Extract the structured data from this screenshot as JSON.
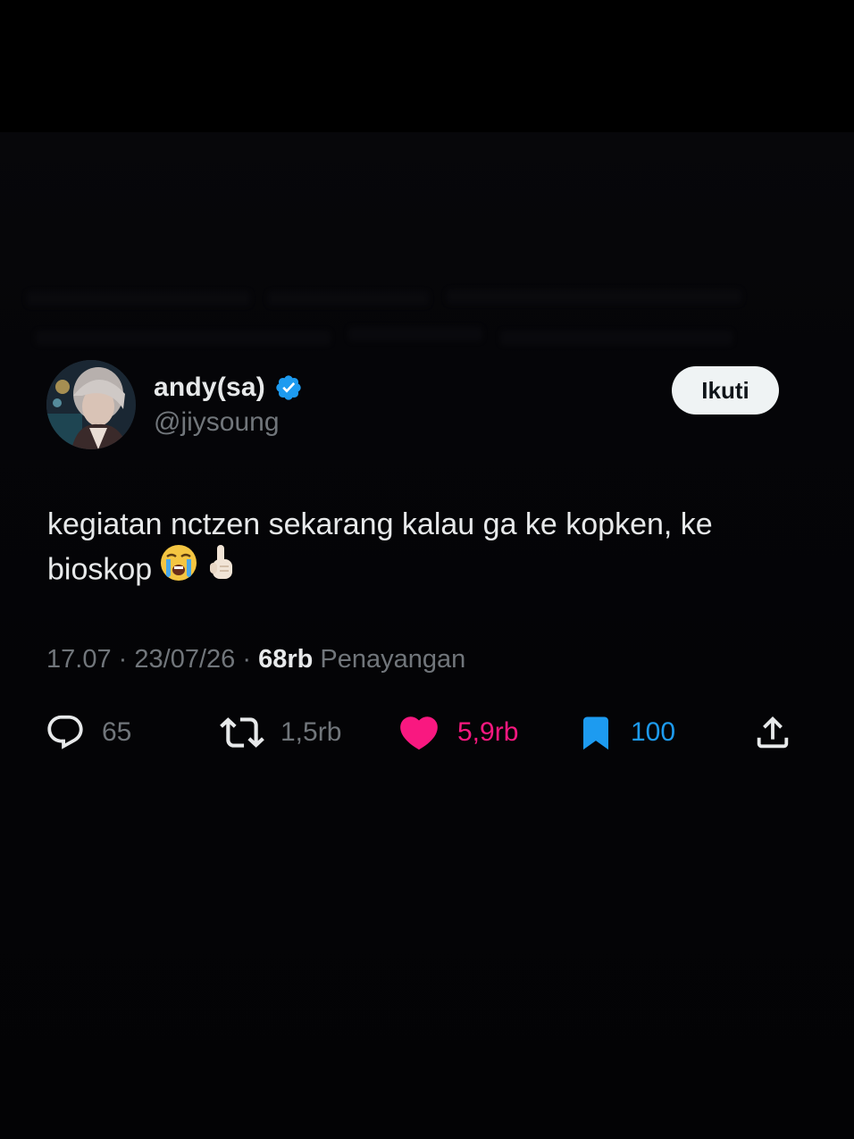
{
  "author": {
    "display_name": "andy(sa)",
    "handle": "@jiysoung",
    "verified": true,
    "verified_color": "#1d9bf0"
  },
  "follow_button": {
    "label": "Ikuti"
  },
  "tweet": {
    "text": "kegiatan nctzen sekarang kalau ga ke kopken, ke bioskop",
    "emojis": [
      "loudly-crying-face-emoji",
      "index-pointing-up-emoji"
    ]
  },
  "meta": {
    "time": "17.07",
    "separator": "·",
    "date": "23/07/26",
    "views_count": "68rb",
    "views_label": "Penayangan"
  },
  "actions": {
    "replies": "65",
    "reposts": "1,5rb",
    "likes": "5,9rb",
    "bookmarks": "100"
  },
  "colors": {
    "background": "#000000",
    "text_primary": "#e7e9ea",
    "text_secondary": "#71767b",
    "like": "#f91880",
    "bookmark": "#1d9bf0",
    "follow_bg": "#eff3f4"
  }
}
